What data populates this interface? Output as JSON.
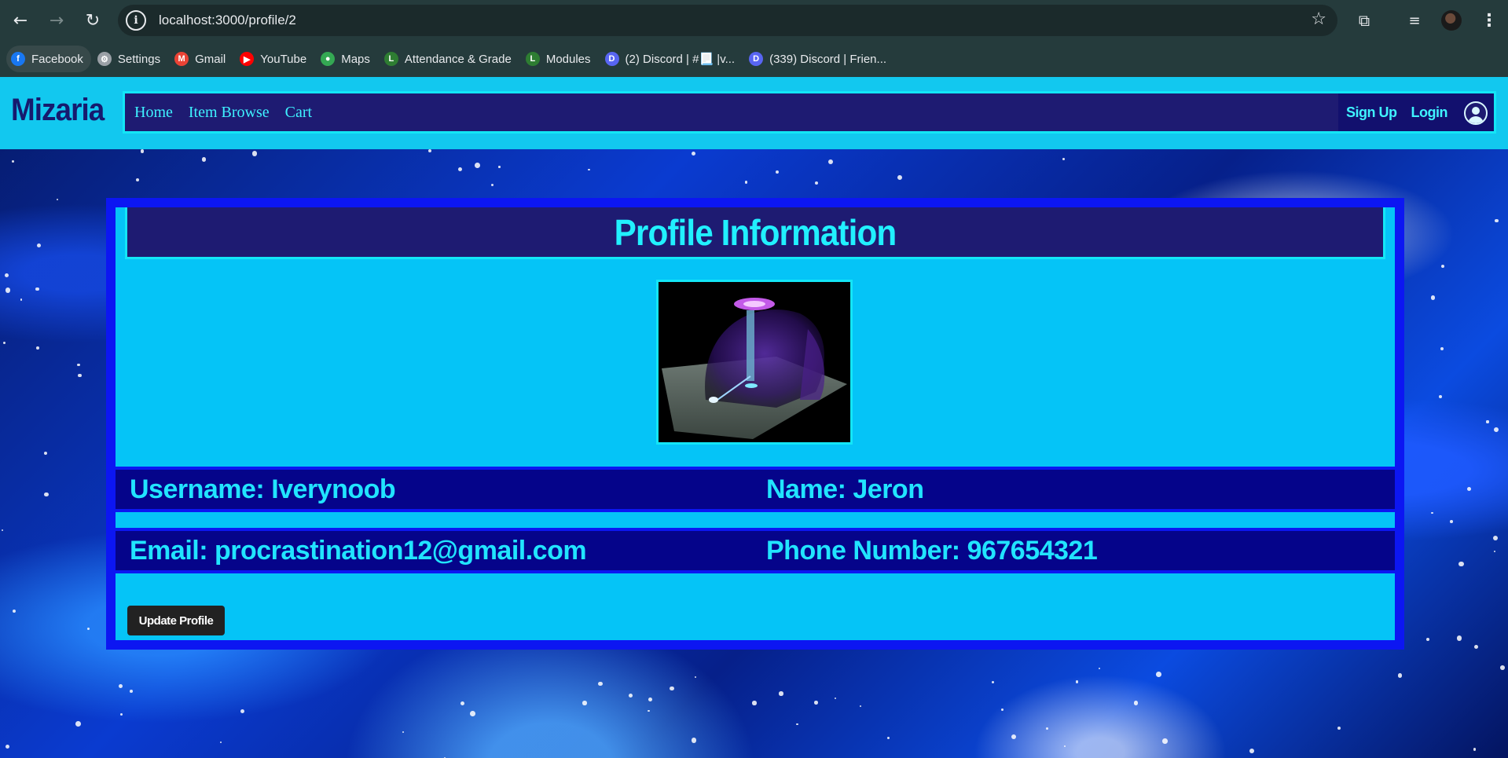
{
  "browser": {
    "url": "localhost:3000/profile/2",
    "bookmarks": [
      {
        "label": "Facebook",
        "icon": "facebook-icon",
        "color": "#1877f2",
        "glyph": "f"
      },
      {
        "label": "Settings",
        "icon": "gear-icon",
        "color": "#9aa0a6",
        "glyph": "⚙"
      },
      {
        "label": "Gmail",
        "icon": "gmail-icon",
        "color": "#ea4335",
        "glyph": "M"
      },
      {
        "label": "YouTube",
        "icon": "youtube-icon",
        "color": "#ff0000",
        "glyph": "▶"
      },
      {
        "label": "Maps",
        "icon": "maps-icon",
        "color": "#34a853",
        "glyph": "●"
      },
      {
        "label": "Attendance & Grade",
        "icon": "leo-icon",
        "color": "#2e7d32",
        "glyph": "L"
      },
      {
        "label": "Modules",
        "icon": "leo-icon",
        "color": "#2e7d32",
        "glyph": "L"
      },
      {
        "label": "(2) Discord | #📃 |v...",
        "icon": "discord-icon",
        "color": "#5865f2",
        "glyph": "D"
      },
      {
        "label": "(339) Discord | Frien...",
        "icon": "discord-icon",
        "color": "#5865f2",
        "glyph": "D"
      }
    ]
  },
  "site": {
    "brand": "Mizaria",
    "nav": [
      "Home",
      "Item Browse",
      "Cart"
    ],
    "sign_up": "Sign Up",
    "login": "Login"
  },
  "profile": {
    "title": "Profile Information",
    "username": "Username: Iverynoob",
    "name": "Name: Jeron",
    "email": "Email: procrastination12@gmail.com",
    "phone": "Phone Number: 967654321",
    "update_button": "Update Profile"
  }
}
